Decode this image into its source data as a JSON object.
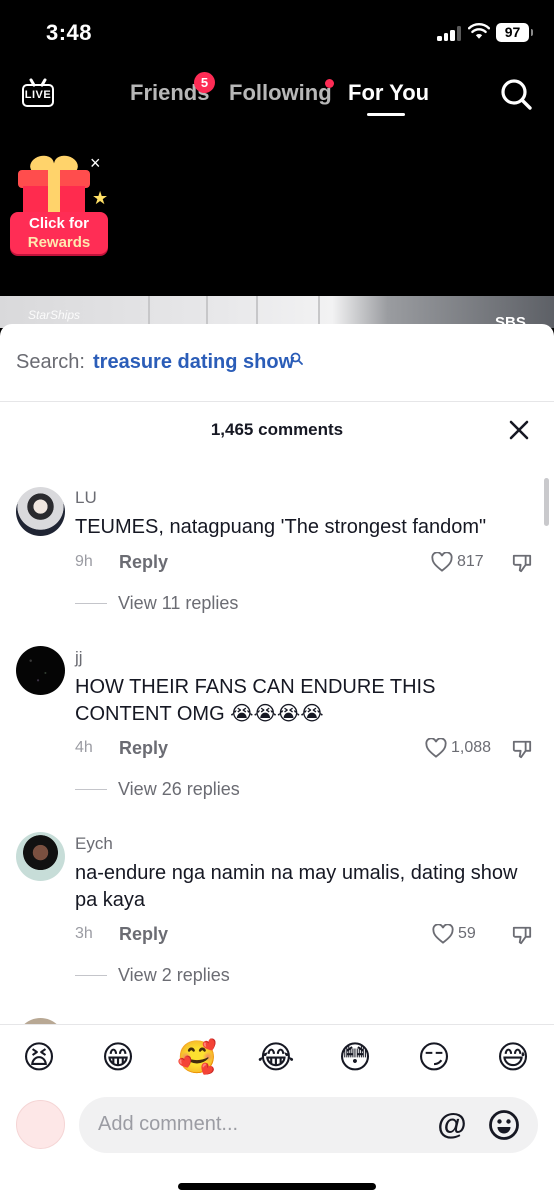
{
  "status_bar": {
    "time": "3:48",
    "battery": "97"
  },
  "top_nav": {
    "live_label": "LIVE",
    "tabs": [
      {
        "label": "Friends",
        "badge": "5"
      },
      {
        "label": "Following"
      },
      {
        "label": "For You",
        "active": true
      }
    ]
  },
  "rewards": {
    "line1": "Click for",
    "line2": "Rewards"
  },
  "video": {
    "watermark": "StarShips",
    "channel_logo": "SBS"
  },
  "comments_sheet": {
    "search_prefix": "Search:",
    "search_query": "treasure dating show",
    "count_label": "1,465 comments",
    "comments": [
      {
        "username": "LU",
        "text": "TEUMES, natagpuang 'The strongest fandom\"",
        "time": "9h",
        "reply_label": "Reply",
        "likes": "817",
        "view_replies": "View 11 replies"
      },
      {
        "username": "jj",
        "text": "HOW THEIR FANS CAN ENDURE THIS CONTENT OMG 😭😭😭😭",
        "time": "4h",
        "reply_label": "Reply",
        "likes": "1,088",
        "view_replies": "View 26 replies"
      },
      {
        "username": "Eych",
        "text": "na-endure nga namin na may umalis, dating show pa kaya",
        "time": "3h",
        "reply_label": "Reply",
        "likes": "59",
        "view_replies": "View 2 replies"
      }
    ]
  },
  "emoji_bar": [
    "😫",
    "😁",
    "🥰",
    "😂",
    "😳",
    "😏",
    "😅"
  ],
  "comment_input": {
    "placeholder": "Add comment...",
    "at_symbol": "@"
  },
  "colors": {
    "accent_red": "#fe2c55",
    "link_blue": "#2b5db8"
  }
}
